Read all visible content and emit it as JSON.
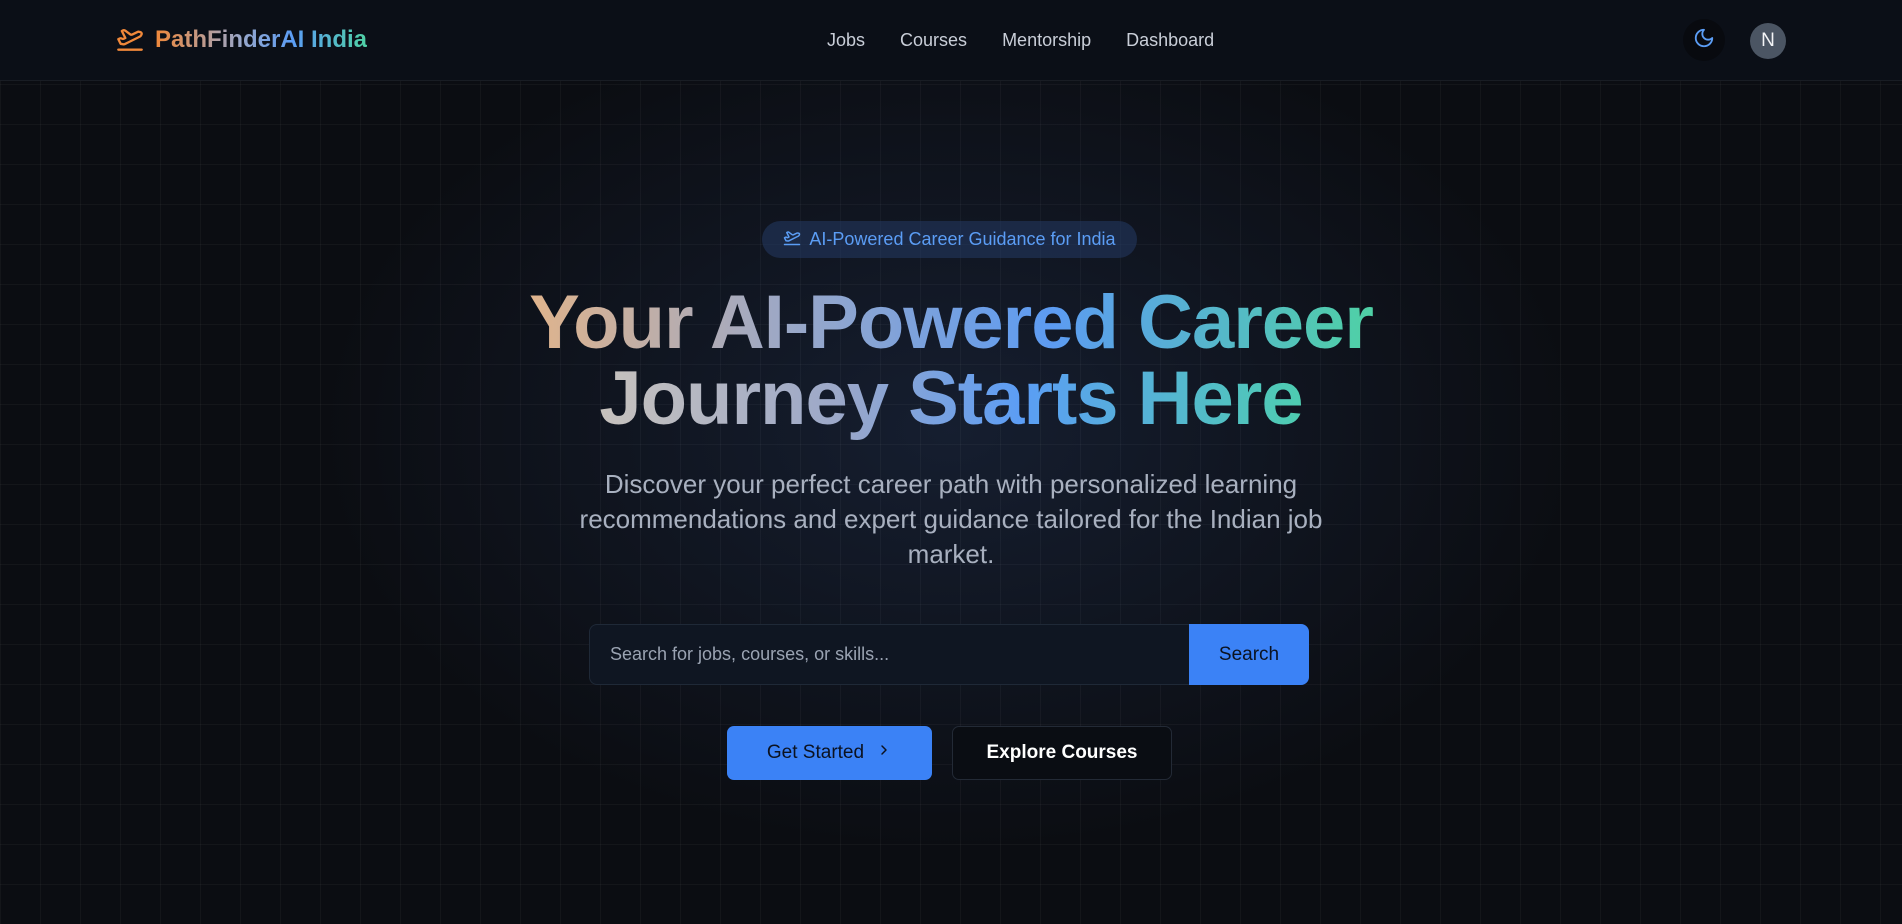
{
  "header": {
    "brand_name": "PathFinderAI India",
    "brand_icon": "plane-takeoff-icon",
    "nav": {
      "jobs": "Jobs",
      "courses": "Courses",
      "mentorship": "Mentorship",
      "dashboard": "Dashboard"
    },
    "theme_icon": "moon-icon",
    "avatar_initial": "N"
  },
  "hero": {
    "badge_icon": "plane-takeoff-icon",
    "badge_text": "AI-Powered Career Guidance for India",
    "headline_line1": "Your AI-Powered Career",
    "headline_line2": "Journey Starts Here",
    "subtitle": "Discover your perfect career path with personalized learning recommendations and expert guidance tailored for the Indian job market.",
    "search": {
      "placeholder": "Search for jobs, courses, or skills...",
      "value": "",
      "button_label": "Search"
    },
    "primary_cta": "Get Started",
    "primary_cta_icon": "chevron-right-icon",
    "secondary_cta": "Explore Courses"
  },
  "colors": {
    "accent": "#3b82f6",
    "brand_orange": "#f0883a",
    "brand_green": "#4fd1a5",
    "background": "#0b0d12"
  }
}
